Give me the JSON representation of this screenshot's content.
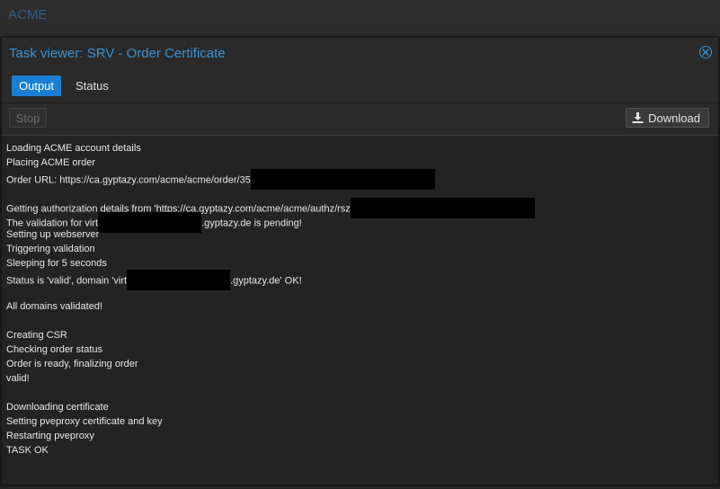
{
  "background": {
    "app_title": "ACME"
  },
  "window": {
    "title": "Task viewer: SRV - Order Certificate",
    "close_icon": "close-circle-icon"
  },
  "tabs": [
    {
      "label": "Output",
      "active": true
    },
    {
      "label": "Status",
      "active": false
    }
  ],
  "toolbar": {
    "stop_label": "Stop",
    "stop_enabled": false,
    "download_label": "Download",
    "download_icon": "download-icon"
  },
  "log": [
    {
      "text": "Loading ACME account details"
    },
    {
      "text": "Placing ACME order"
    },
    {
      "text": "Order URL: https://ca.gyptazy.com/acme/acme/order/35",
      "redacted_after": true
    },
    {
      "text": ""
    },
    {
      "text": "Getting authorization details from 'https://ca.gyptazy.com/acme/acme/authz/rsz",
      "redacted_after": true
    },
    {
      "text": "The validation for virt",
      "redacted_mid": true,
      "suffix": ".gyptazy.de is pending!"
    },
    {
      "text": "Setting up webserver"
    },
    {
      "text": "Triggering validation"
    },
    {
      "text": "Sleeping for 5 seconds"
    },
    {
      "text": "Status is 'valid', domain 'virt",
      "redacted_mid": true,
      "suffix": ".gyptazy.de' OK!"
    },
    {
      "text": ""
    },
    {
      "text": "All domains validated!"
    },
    {
      "text": ""
    },
    {
      "text": "Creating CSR"
    },
    {
      "text": "Checking order status"
    },
    {
      "text": "Order is ready, finalizing order"
    },
    {
      "text": "valid!"
    },
    {
      "text": ""
    },
    {
      "text": "Downloading certificate"
    },
    {
      "text": "Setting pveproxy certificate and key"
    },
    {
      "text": "Restarting pveproxy"
    },
    {
      "text": "TASK OK"
    }
  ]
}
